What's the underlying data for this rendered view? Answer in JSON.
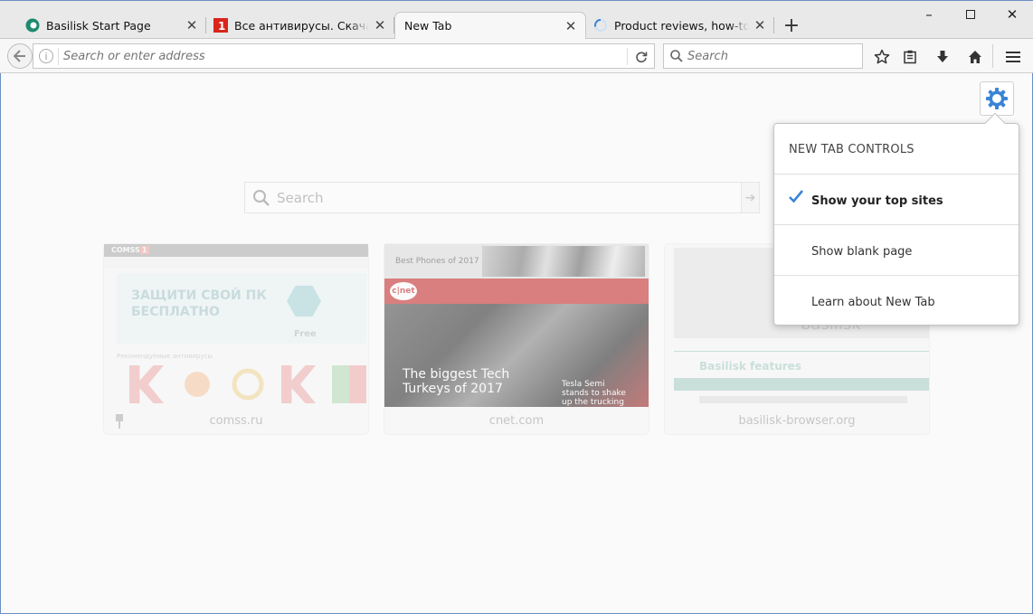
{
  "tabs": [
    {
      "title": "Basilisk Start Page",
      "active": false
    },
    {
      "title": "Все антивирусы. Скачать бесплатные",
      "active": false
    },
    {
      "title": "New Tab",
      "active": true
    },
    {
      "title": "Product reviews, how-tos, deals",
      "active": false
    }
  ],
  "navbar": {
    "url_placeholder": "Search or enter address",
    "search_placeholder": "Search"
  },
  "newtab": {
    "search_placeholder": "Search",
    "tiles": [
      {
        "label": "comss.ru",
        "thumb": {
          "logo": "COMSS",
          "logo_mark": "1",
          "banner_line1": "ЗАЩИТИ СВОЙ ПК",
          "banner_line2": "БЕСПЛАТНО",
          "badge": "Free",
          "section": "Рекомендуемые антивирусы"
        }
      },
      {
        "label": "cnet.com",
        "thumb": {
          "banner_text": "Best Phones of 2017",
          "logo": "c|net",
          "headline_line1": "The biggest Tech",
          "headline_line2": "Turkeys of 2017",
          "side_line1": "Tesla Semi",
          "side_line2": "stands to shake",
          "side_line3": "up the trucking"
        }
      },
      {
        "label": "basilisk-browser.org",
        "thumb": {
          "wordmark": "basilisk",
          "heading": "Basilisk features"
        }
      }
    ]
  },
  "popup": {
    "title": "NEW TAB CONTROLS",
    "options": [
      {
        "label": "Show your top sites",
        "checked": true
      },
      {
        "label": "Show blank page",
        "checked": false
      },
      {
        "label": "Learn about New Tab",
        "checked": false
      }
    ]
  },
  "colors": {
    "accent": "#3a84d6",
    "frame_border": "#6b8fc4",
    "cnet_red": "#c21e1e",
    "basilisk_green": "#2a8c78",
    "comss_teal": "#29a0a8"
  }
}
